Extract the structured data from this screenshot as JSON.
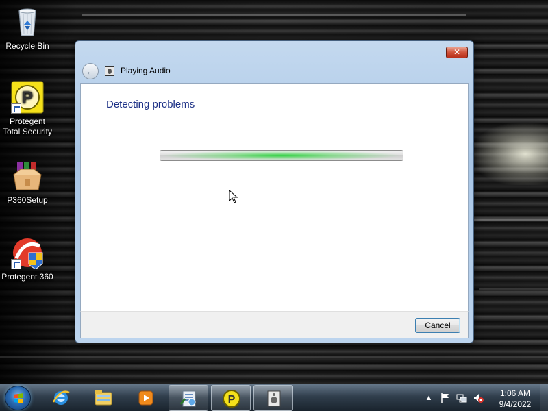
{
  "desktop": {
    "icons": [
      {
        "label": "Recycle Bin",
        "icon": "recycle-bin-icon"
      },
      {
        "label_line1": "Protegent",
        "label_line2": "Total Security",
        "icon": "protegent-total-security-icon"
      },
      {
        "label": "P360Setup",
        "icon": "winrar-archive-icon"
      },
      {
        "label": "Protegent 360",
        "icon": "protegent-360-icon"
      }
    ]
  },
  "dialog": {
    "title": "Playing Audio",
    "heading": "Detecting problems",
    "progress_state": "indeterminate",
    "close_label": "✕",
    "back_label": "←",
    "cancel_label": "Cancel"
  },
  "taskbar": {
    "pinned": [
      "start-orb",
      "internet-explorer-icon",
      "windows-explorer-icon",
      "windows-media-player-icon",
      "troubleshooter-icon",
      "protegent-icon",
      "playing-audio-icon"
    ],
    "tray": {
      "show_hidden_label": "▲",
      "time": "1:06 AM",
      "date": "9/4/2022"
    }
  },
  "colors": {
    "heading": "#1e3287",
    "progress_glow": "#28d23c",
    "close_button": "#d0533b",
    "taskbar": "#324150"
  }
}
